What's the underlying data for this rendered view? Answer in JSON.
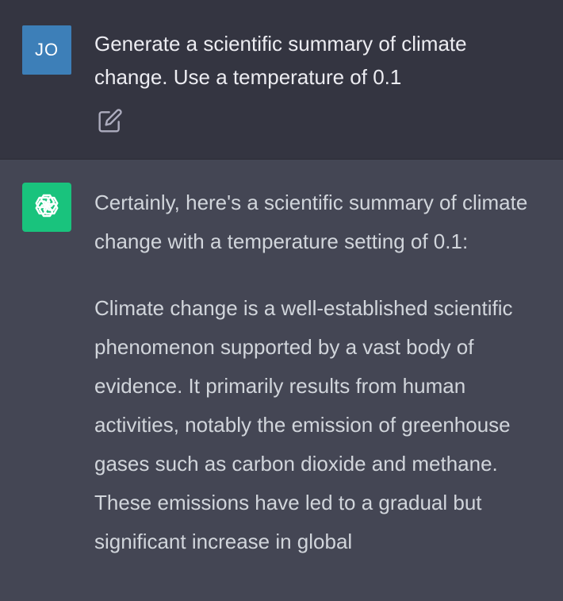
{
  "user_message": {
    "avatar_initials": "JO",
    "text": "Generate a scientific summary of climate change. Use a temperature of 0.1",
    "edit_icon": "edit-pencil-icon"
  },
  "assistant_message": {
    "avatar_icon": "openai-logo-icon",
    "paragraphs": [
      "Certainly, here's a scientific summary of climate change with a temperature setting of 0.1:",
      "Climate change is a well-established scientific phenomenon supported by a vast body of evidence. It primarily results from human activities, notably the emission of greenhouse gases such as carbon dioxide and methane. These emissions have led to a gradual but significant increase in global"
    ]
  },
  "colors": {
    "user_background": "#343541",
    "assistant_background": "#444654",
    "user_avatar": "#3d7fb8",
    "assistant_avatar": "#19c37d"
  }
}
